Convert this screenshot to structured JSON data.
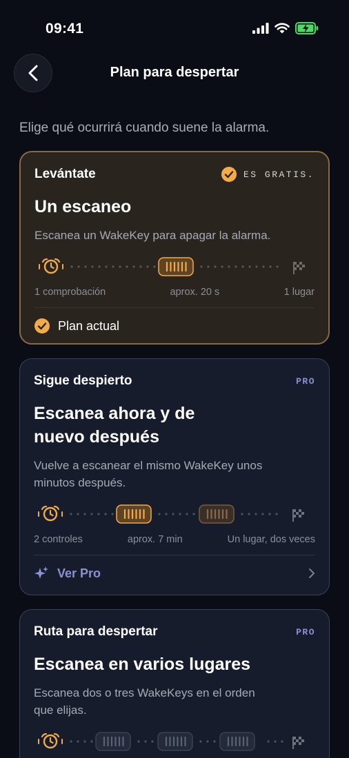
{
  "status": {
    "time": "09:41"
  },
  "nav": {
    "title": "Plan para despertar"
  },
  "subtitle": "Elige qué ocurrirá cuando suene la alarma.",
  "colors": {
    "accent": "#f1ab4a",
    "pro": "#8a92d4",
    "background": "#0a0d15"
  },
  "cards": [
    {
      "kicker": "Levántate",
      "badge": "ES GRATIS.",
      "title": "Un escaneo",
      "description": "Escanea un WakeKey para apagar la alarma.",
      "meta": [
        "1 comprobación",
        "aprox. 20 s",
        "1 lugar"
      ],
      "footer": "Plan actual"
    },
    {
      "kicker": "Sigue despierto",
      "badge": "PRO",
      "title_lines": [
        "Escanea ahora y de",
        "nuevo después"
      ],
      "description_lines": [
        "Vuelve a escanear el mismo WakeKey unos",
        "minutos después."
      ],
      "meta": [
        "2 controles",
        "aprox. 7 min",
        "Un lugar, dos veces"
      ],
      "footer": "Ver Pro"
    },
    {
      "kicker": "Ruta para despertar",
      "badge": "PRO",
      "title": "Escanea en varios lugares",
      "description_lines": [
        "Escanea dos o tres WakeKeys en el orden",
        "que elijas."
      ]
    }
  ]
}
